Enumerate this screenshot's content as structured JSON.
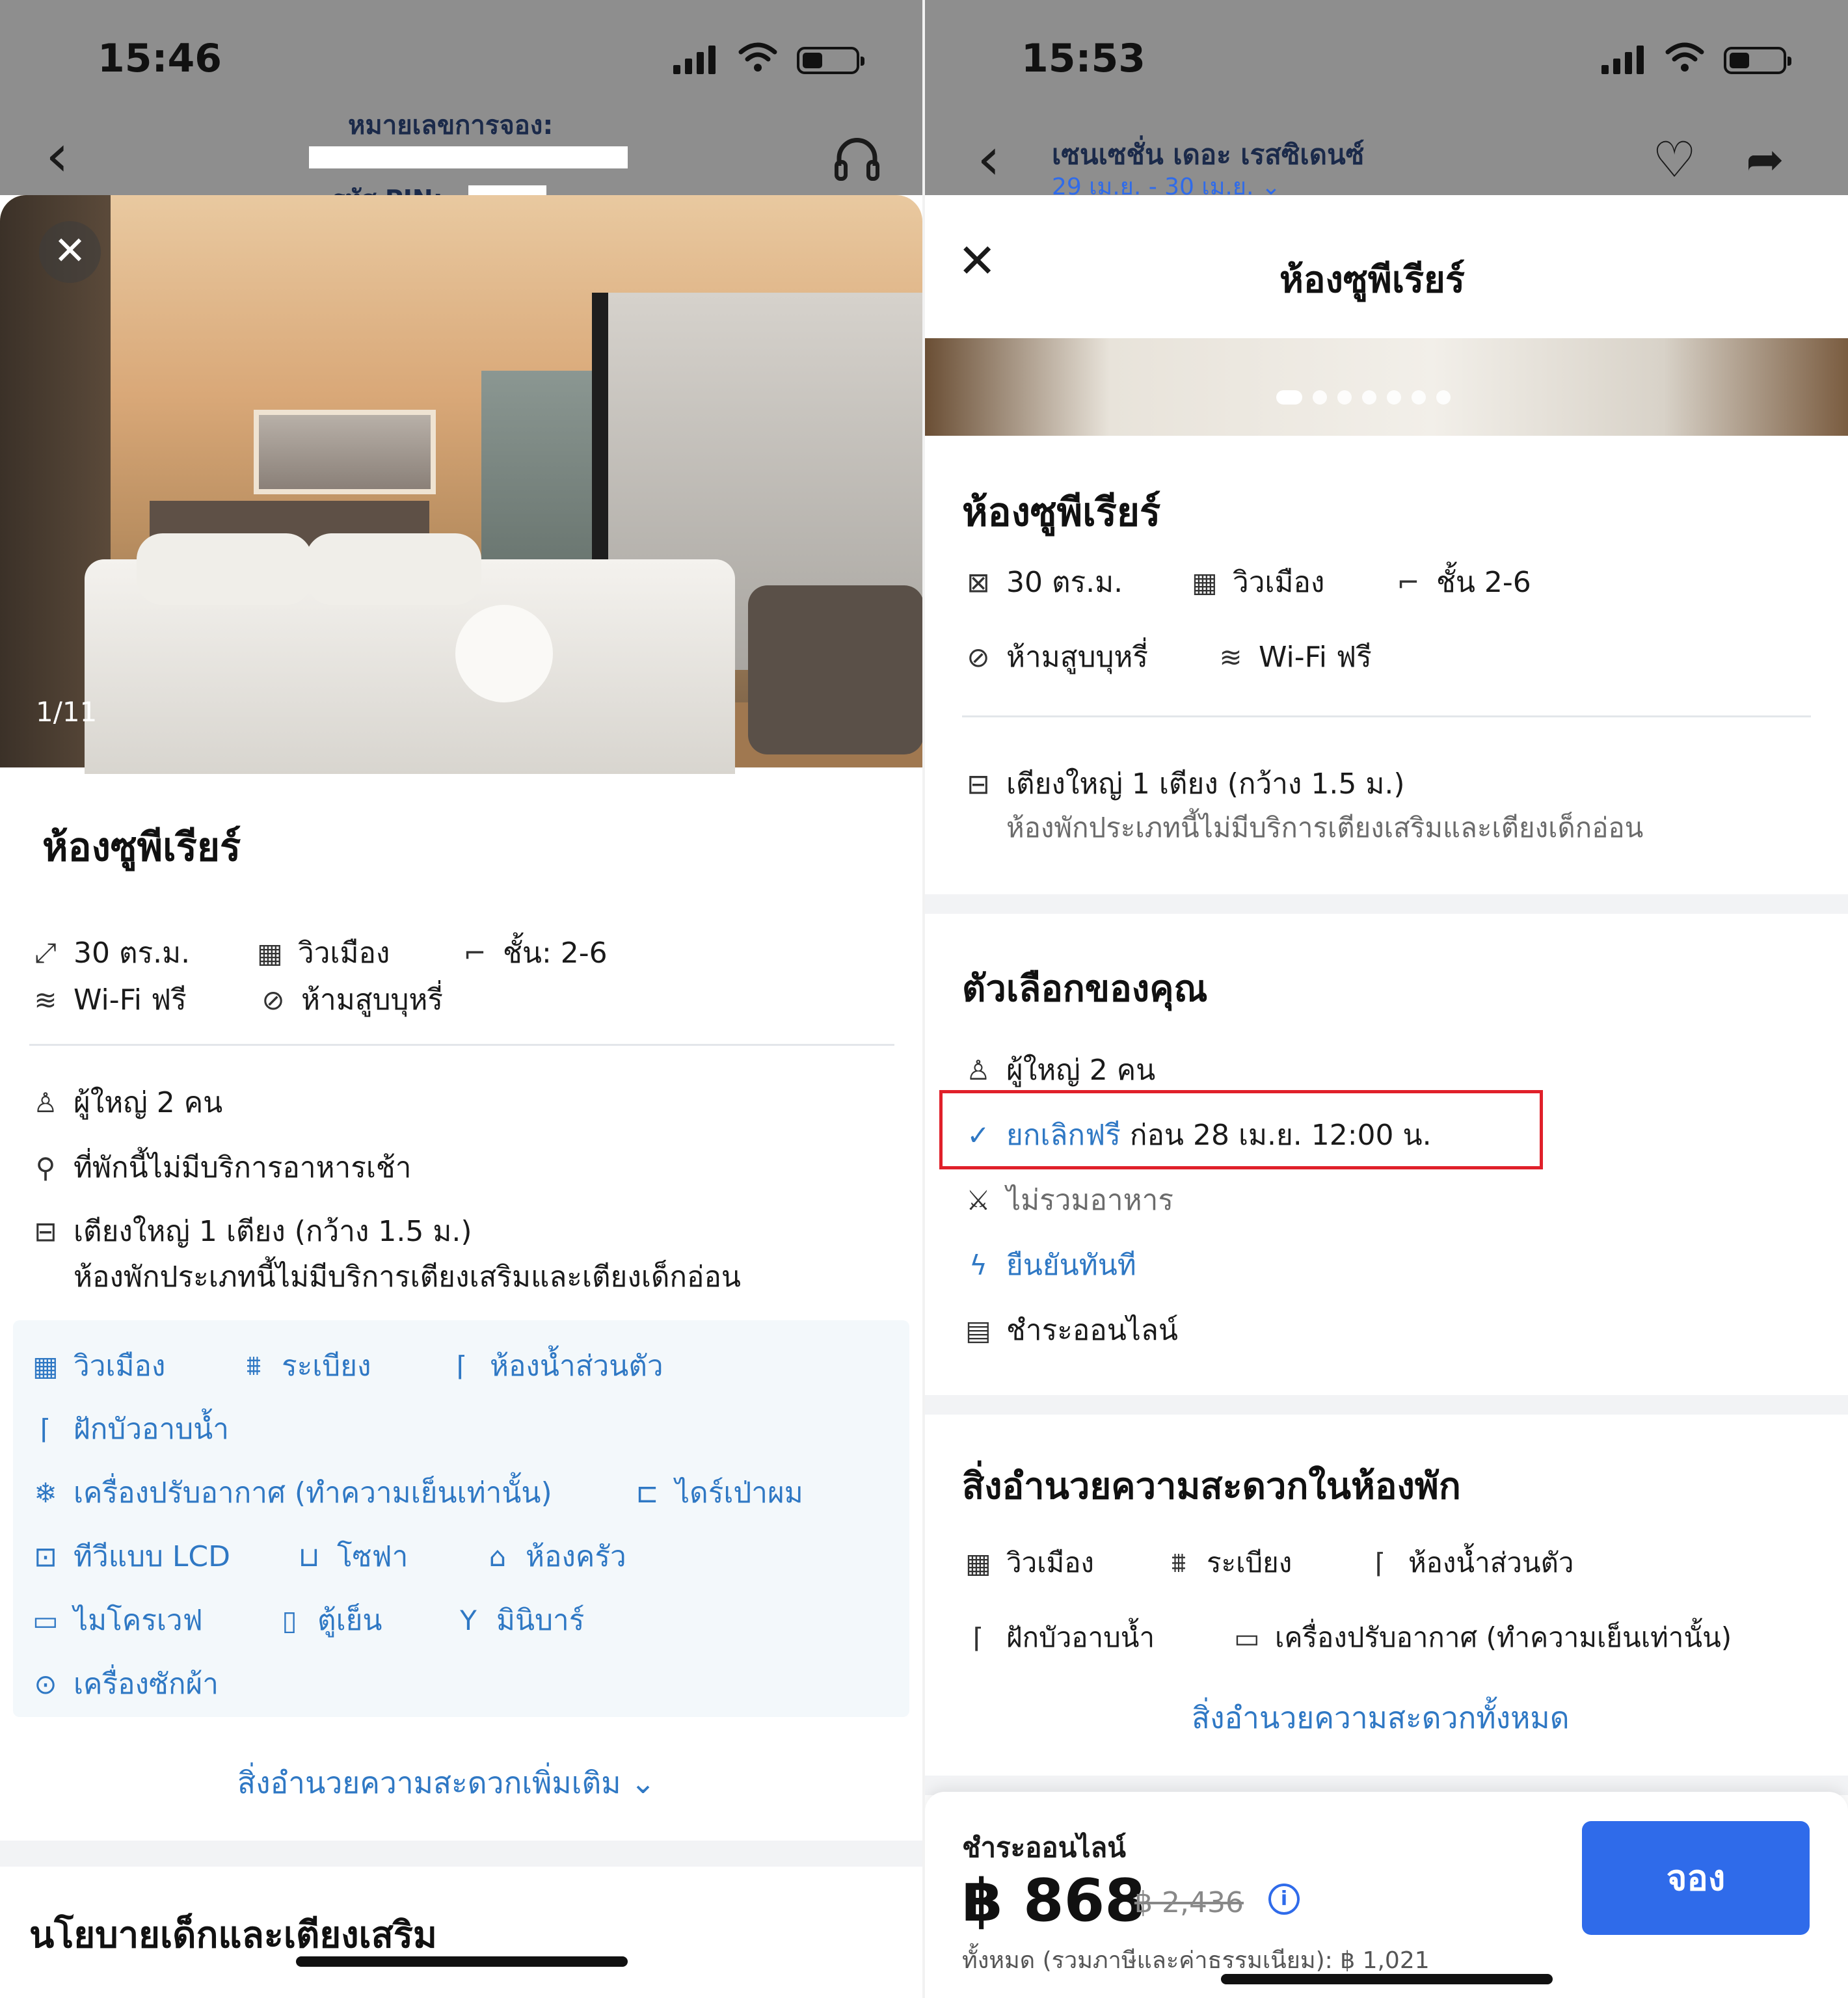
{
  "left": {
    "status": {
      "time": "15:46"
    },
    "header": {
      "booking_label": "หมายเลขการจอง:",
      "pin_label": "รหัส PIN:"
    },
    "gallery": {
      "counter": "1/11"
    },
    "room_title": "ห้องซูพีเรียร์",
    "features": [
      {
        "icon": "room-size-icon",
        "label": "30 ตร.ม."
      },
      {
        "icon": "city-view-icon",
        "label": "วิวเมือง"
      },
      {
        "icon": "stairs-icon",
        "label": "ชั้น: 2-6"
      },
      {
        "icon": "wifi-icon",
        "label": "Wi-Fi ฟรี"
      },
      {
        "icon": "no-smoking-icon",
        "label": "ห้ามสูบบุหรี่"
      }
    ],
    "details": {
      "adults": "ผู้ใหญ่ 2 คน",
      "breakfast": "ที่พักนี้ไม่มีบริการอาหารเช้า",
      "bed": "เตียงใหญ่ 1 เตียง (กว้าง 1.5 ม.)",
      "bed_note": "ห้องพักประเภทนี้ไม่มีบริการเตียงเสริมและเตียงเด็กอ่อน"
    },
    "amenities": [
      "วิวเมือง",
      "ระเบียง",
      "ห้องน้ำส่วนตัว",
      "ฝักบัวอาบน้ำ",
      "เครื่องปรับอากาศ (ทำความเย็นเท่านั้น)",
      "ไดร์เป่าผม",
      "ทีวีแบบ LCD",
      "โซฟา",
      "ห้องครัว",
      "ไมโครเวฟ",
      "ตู้เย็น",
      "มินิบาร์",
      "เครื่องซักผ้า"
    ],
    "more_link": "สิ่งอำนวยความสะดวกเพิ่มเติม",
    "policy_title": "นโยบายเด็กและเตียงเสริม"
  },
  "right": {
    "status": {
      "time": "15:53"
    },
    "header": {
      "hotel_name": "เซนเซชั่น เดอะ เรสซิเดนซ์",
      "dates": "29 เม.ย. - 30 เม.ย."
    },
    "sheet_title": "ห้องซูพีเรียร์",
    "room_title": "ห้องซูพีเรียร์",
    "features": [
      {
        "icon": "room-size-icon",
        "label": "30 ตร.ม."
      },
      {
        "icon": "city-view-icon",
        "label": "วิวเมือง"
      },
      {
        "icon": "stairs-icon",
        "label": "ชั้น 2-6"
      },
      {
        "icon": "no-smoking-icon",
        "label": "ห้ามสูบบุหรี่"
      },
      {
        "icon": "wifi-icon",
        "label": "Wi-Fi ฟรี"
      }
    ],
    "bed": "เตียงใหญ่ 1 เตียง (กว้าง 1.5 ม.)",
    "bed_note": "ห้องพักประเภทนี้ไม่มีบริการเตียงเสริมและเตียงเด็กอ่อน",
    "options_title": "ตัวเลือกของคุณ",
    "options": {
      "adults": "ผู้ใหญ่ 2 คน",
      "free_cancel": "ยกเลิกฟรี",
      "cancel_deadline": "ก่อน 28 เม.ย. 12:00 น.",
      "meals": "ไม่รวมอาหาร",
      "instant": "ยืนยันทันที",
      "pay_online": "ชำระออนไลน์"
    },
    "amenities_title": "สิ่งอำนวยความสะดวกในห้องพัก",
    "amenities": [
      "วิวเมือง",
      "ระเบียง",
      "ห้องน้ำส่วนตัว",
      "ฝักบัวอาบน้ำ",
      "เครื่องปรับอากาศ (ทำความเย็นเท่านั้น)"
    ],
    "all_link": "สิ่งอำนวยความสะดวกทั้งหมด",
    "footer": {
      "pay_label": "ชำระออนไลน์",
      "price": "฿ 868",
      "old_price": "฿ 2,436",
      "total": "ทั้งหมด (รวมภาษีและค่าธรรมเนียม): ฿ 1,021",
      "book_label": "จอง"
    }
  },
  "colors": {
    "accent_blue": "#2f6bea",
    "link_blue": "#2f78c4",
    "highlight_red": "#e0202a"
  }
}
